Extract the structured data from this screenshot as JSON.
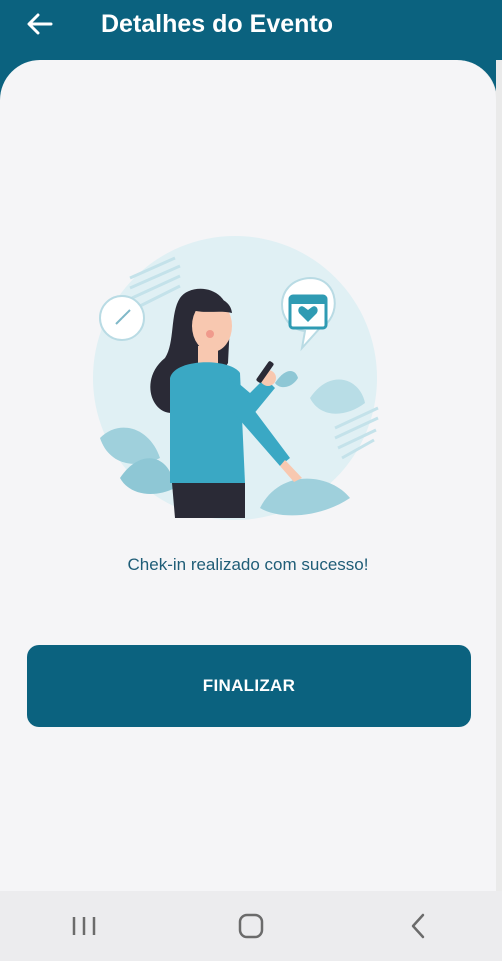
{
  "header": {
    "title": "Detalhes do Evento",
    "back_icon": "arrow-left-icon"
  },
  "main": {
    "illustration": "woman-with-phone-checkin-illustration",
    "success_message": "Chek-in realizado com sucesso!",
    "finalize_label": "FINALIZAR"
  },
  "system_nav": {
    "items": [
      "recent-apps-icon",
      "home-icon",
      "back-icon"
    ]
  },
  "colors": {
    "primary": "#0b627f",
    "background": "#f5f5f7",
    "text": "#1f5d77"
  }
}
